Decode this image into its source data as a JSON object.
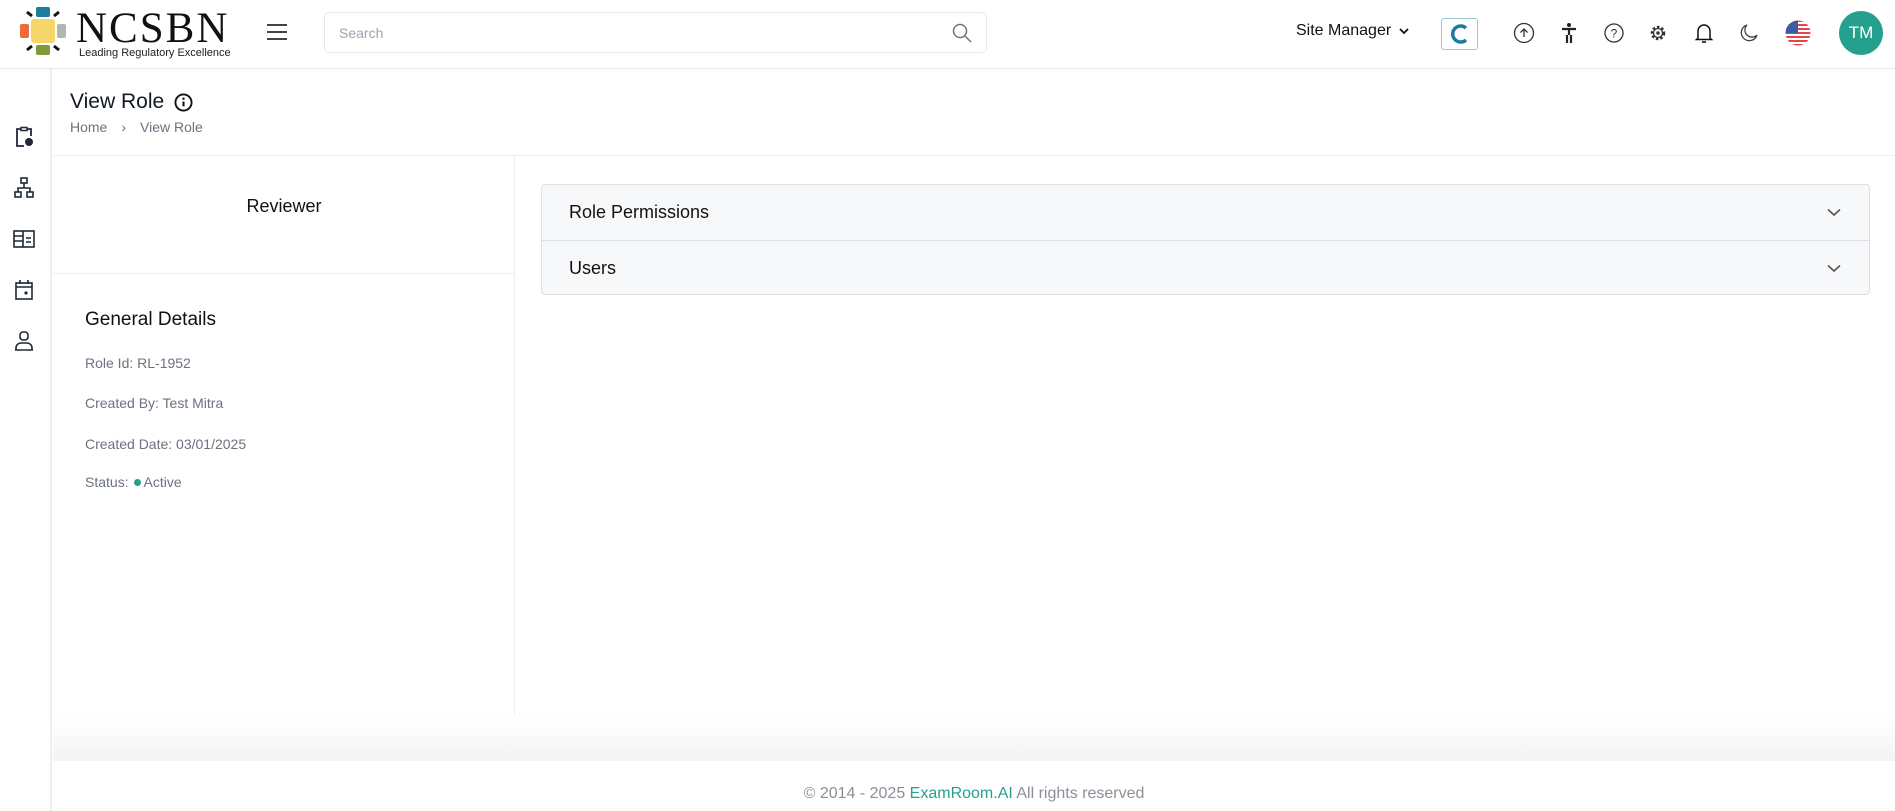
{
  "header": {
    "logo_text": "NCSBN",
    "logo_tagline": "Leading Regulatory Excellence",
    "search_placeholder": "Search",
    "site_manager": "Site Manager",
    "avatar_initials": "TM"
  },
  "sidebar": {
    "items": [
      "exam-schedule",
      "organization",
      "directory",
      "calendar",
      "user"
    ]
  },
  "page": {
    "title": "View Role",
    "breadcrumb": [
      "Home",
      "View Role"
    ]
  },
  "role": {
    "name": "Reviewer",
    "section": "General Details",
    "role_id": "Role Id: RL-1952",
    "created_by": "Created By: Test Mitra",
    "created_date": "Created Date: 03/01/2025",
    "status_label": "Status:",
    "status": "Active"
  },
  "accordion": [
    {
      "label": "Role Permissions"
    },
    {
      "label": "Users"
    }
  ],
  "footer": {
    "prefix": "© 2014 - 2025 ",
    "link": "ExamRoom.AI",
    "suffix": " All rights reserved"
  },
  "colors": {
    "accent": "#26a08e"
  }
}
